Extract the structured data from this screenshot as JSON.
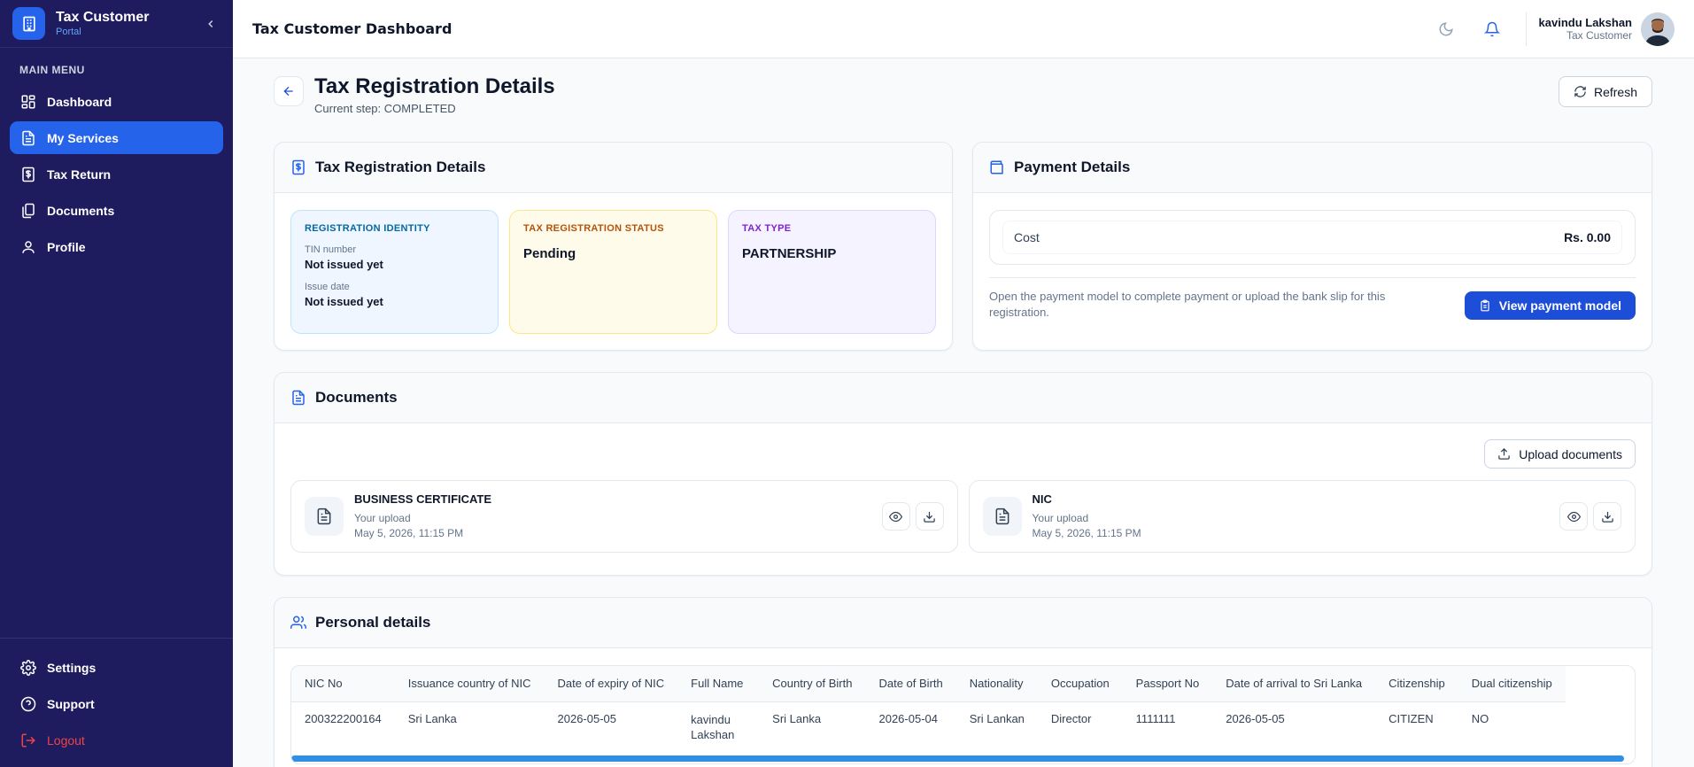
{
  "brand": {
    "title": "Tax Customer",
    "subtitle": "Portal"
  },
  "sidebar": {
    "menu_label": "MAIN MENU",
    "items": [
      {
        "label": "Dashboard",
        "icon": "dashboard-icon"
      },
      {
        "label": "My Services",
        "icon": "document-icon",
        "active": true
      },
      {
        "label": "Tax Return",
        "icon": "tax-return-icon"
      },
      {
        "label": "Documents",
        "icon": "documents-icon"
      },
      {
        "label": "Profile",
        "icon": "user-icon"
      }
    ],
    "bottom": [
      {
        "label": "Settings",
        "icon": "gear-icon"
      },
      {
        "label": "Support",
        "icon": "help-icon"
      },
      {
        "label": "Logout",
        "icon": "logout-icon"
      }
    ]
  },
  "topbar": {
    "title": "Tax Customer Dashboard",
    "user_name": "kavindu Lakshan",
    "user_role": "Tax Customer"
  },
  "page": {
    "title": "Tax Registration Details",
    "step": "Current step: COMPLETED",
    "refresh_label": "Refresh"
  },
  "registration": {
    "card_title": "Tax Registration Details",
    "identity": {
      "label": "REGISTRATION IDENTITY",
      "tin_label": "TIN number",
      "tin_value": "Not issued yet",
      "issue_label": "Issue date",
      "issue_value": "Not issued yet"
    },
    "status": {
      "label": "TAX REGISTRATION STATUS",
      "value": "Pending"
    },
    "tax_type": {
      "label": "TAX TYPE",
      "value": "PARTNERSHIP"
    }
  },
  "payment": {
    "card_title": "Payment Details",
    "cost_label": "Cost",
    "cost_value": "Rs. 0.00",
    "note": "Open the payment model to complete payment or upload the bank slip for this registration.",
    "button_label": "View payment model"
  },
  "documents": {
    "card_title": "Documents",
    "upload_label": "Upload documents",
    "items": [
      {
        "name": "BUSINESS CERTIFICATE",
        "source": "Your upload",
        "date": "May 5, 2026, 11:15 PM"
      },
      {
        "name": "NIC",
        "source": "Your upload",
        "date": "May 5, 2026, 11:15 PM"
      }
    ]
  },
  "personal": {
    "card_title": "Personal details",
    "columns": [
      "NIC No",
      "Issuance country of NIC",
      "Date of expiry of NIC",
      "Full Name",
      "Country of Birth",
      "Date of Birth",
      "Nationality",
      "Occupation",
      "Passport No",
      "Date of arrival to Sri Lanka",
      "Citizenship",
      "Dual citizenship"
    ],
    "rows": [
      [
        "200322200164",
        "Sri Lanka",
        "2026-05-05",
        "kavindu Lakshan",
        "Sri Lanka",
        "2026-05-04",
        "Sri Lankan",
        "Director",
        "1111111",
        "2026-05-05",
        "CITIZEN",
        "NO"
      ]
    ]
  },
  "colors": {
    "sidebar_bg": "#1e1b5e",
    "accent": "#2563eb",
    "logout": "#ef4444"
  }
}
